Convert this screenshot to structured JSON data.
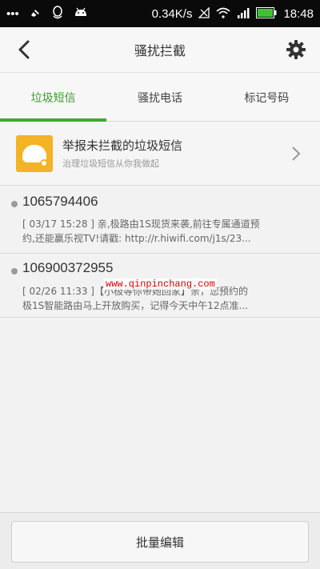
{
  "status_bar": {
    "icons_left": [
      "more-icon",
      "mute-icon",
      "qq-icon",
      "android-icon"
    ],
    "network_speed": "0.34K/s",
    "time": "18:48"
  },
  "header": {
    "title": "骚扰拦截"
  },
  "tabs": [
    {
      "label": "垃圾短信",
      "active": true
    },
    {
      "label": "骚扰电话",
      "active": false
    },
    {
      "label": "标记号码",
      "active": false
    }
  ],
  "report": {
    "title": "举报未拦截的垃圾短信",
    "subtitle": "治理垃圾短信从你我做起"
  },
  "messages": [
    {
      "number": "1065794406",
      "line1": "[ 03/17 15:28 ] 亲,极路由1S现货来袭,前往专属通道预",
      "line2": "约,还能赢乐视TV!请戳: http://r.hiwifi.com/j1s/23..."
    },
    {
      "number": "106900372955",
      "line1": "[ 02/26 11:33 ]【小极等你带她回家】亲，您预约的",
      "line2": "极1S智能路由马上开放购买，记得今天中午12点准..."
    }
  ],
  "watermark": "www.qinpinchang.com",
  "footer": {
    "batch_edit_label": "批量编辑"
  },
  "colors": {
    "accent_green": "#3fa832",
    "report_icon_bg": "#f4b324",
    "watermark_red": "#d40000"
  }
}
